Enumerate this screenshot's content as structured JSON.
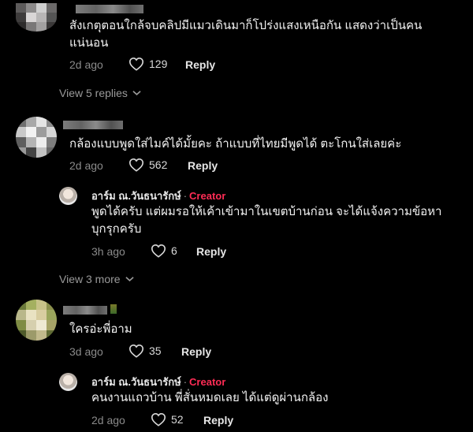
{
  "comments": [
    {
      "text_line1": "สังเกตุตอนใกล้จบคลิปมีแมวเดินมาก็โปร่งแสงเหนือกัน แสดงว่าเป็นคน",
      "text_line2": "แน่นอน",
      "age": "2d ago",
      "likes": "129",
      "reply_label": "Reply",
      "view_replies": "View 5 replies"
    },
    {
      "text": "กล้องแบบพูดใส่ไมค์ได้มั้ยคะ ถ้าแบบที่ไทยมีพูดได้ ตะโกนใส่เลยค่ะ",
      "age": "2d ago",
      "likes": "562",
      "reply_label": "Reply",
      "reply": {
        "author": "อาร์ม ณ.วันธนารักษ์",
        "separator": "·",
        "badge": "Creator",
        "text_line1": "พูดได้ครับ แต่ผมรอให้เค้าเข้ามาในเขตบ้านก่อน จะได้แจ้งความข้อหา",
        "text_line2": "บุกรุกครับ",
        "age": "3h ago",
        "likes": "6",
        "reply_label": "Reply"
      },
      "view_more": "View 3 more"
    },
    {
      "text": "ใครอ่ะพี่อาม",
      "age": "3d ago",
      "likes": "35",
      "reply_label": "Reply",
      "reply": {
        "author": "อาร์ม ณ.วันธนารักษ์",
        "separator": "·",
        "badge": "Creator",
        "text": "คนงานแถวบ้าน พี่สั่นหมดเลย ได้แต่ดูผ่านกล้อง",
        "age": "2d ago",
        "likes": "52",
        "reply_label": "Reply"
      }
    }
  ],
  "icons": {
    "like": "heart-outline-icon",
    "expand": "chevron-down-icon"
  },
  "colors": {
    "background": "#000000",
    "creator": "#fe2c55",
    "muted": "#8a8a8a"
  }
}
